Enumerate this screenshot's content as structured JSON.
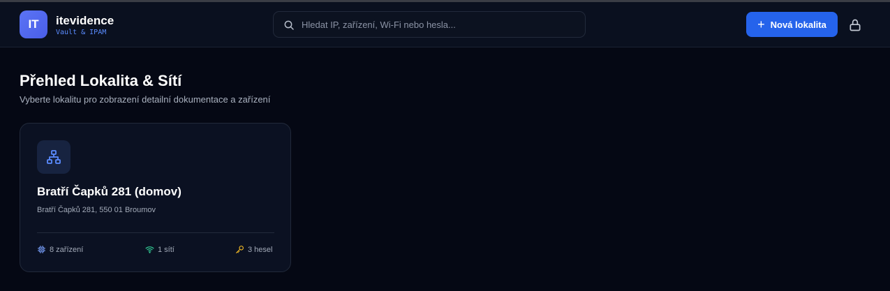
{
  "header": {
    "logo_text": "IT",
    "brand_name": "itevidence",
    "brand_sub": "Vault & IPAM",
    "search_placeholder": "Hledat IP, zařízení, Wi-Fi nebo hesla...",
    "new_button_label": "Nová lokalita",
    "new_button_icon": "plus-icon",
    "lock_icon": "lock-icon"
  },
  "main": {
    "title": "Přehled Lokalita & Sítí",
    "subtitle": "Vyberte lokalitu pro zobrazení detailní dokumentace a zařízení",
    "locations": [
      {
        "icon": "network-icon",
        "name": "Bratří Čapků 281 (domov)",
        "address": "Bratří Čapků 281, 550 01 Broumov",
        "stats": {
          "devices": "8 zařízení",
          "networks": "1 sítí",
          "passwords": "3 hesel"
        }
      }
    ]
  },
  "colors": {
    "accent": "#2563eb",
    "background": "#050814",
    "brand_sub": "#5b8cff",
    "devices_icon": "#7aa2ff",
    "networks_icon": "#34d399",
    "passwords_icon": "#fbbf24"
  }
}
